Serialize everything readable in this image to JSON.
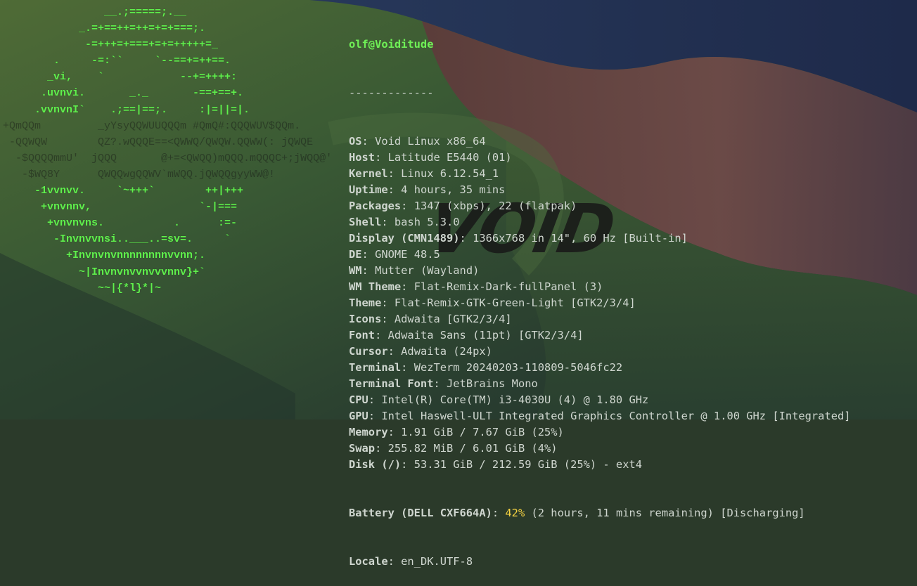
{
  "colors": {
    "logo_green": "#5ff04c",
    "title_green": "#6ff056",
    "text": "#cfd6cf",
    "battery_percent": "#f5d242"
  },
  "wallpaper": {
    "wordmark": "VOID"
  },
  "logo_lines": [
    "                __.;=====;.__",
    "            _.=+==++=++=+=+===;.",
    "             -=+++=+===+=+=+++++=_",
    "        .     -=:``     `--==+=++==.",
    "       _vi,    `            --+=++++:",
    "      .uvnvi.       _._       -==+==+.",
    "     .vvnvnI`    .;==|==;.     :|=||=|.",
    "+QmQQm         _yYsyQQWUUQQQm #QmQ#:QQQWUV$QQm.",
    " -QQWQW        QZ?.wQQQE==<QWWQ/QWQW.QQWW(: jQWQE",
    "  -$QQQQmmU'  jQQQ       @+=<QWQQ)mQQQ.mQQQC+;jWQQ@'",
    "   -$WQ8Y      QWQQwgQQWV`mWQQ.jQWQQgyyWW@!",
    "     -1vvnvv.     `~+++`        ++|+++",
    "      +vnvnnv,                 `-|===",
    "       +vnvnvns.           .      :=-",
    "        -Invnvvnsi..___..=sv=.     `",
    "          +Invnvnvnnnnnnnnvvnn;.",
    "            ~|Invnvnvvnvvvnnv}+`",
    "               ~~|{*l}*|~"
  ],
  "fetch": {
    "user_host": "olf@Voiditude",
    "separator": "-------------",
    "rows": [
      {
        "key": "OS",
        "value": "Void Linux x86_64"
      },
      {
        "key": "Host",
        "value": "Latitude E5440 (01)"
      },
      {
        "key": "Kernel",
        "value": "Linux 6.12.54_1"
      },
      {
        "key": "Uptime",
        "value": "4 hours, 35 mins"
      },
      {
        "key": "Packages",
        "value": "1347 (xbps), 22 (flatpak)"
      },
      {
        "key": "Shell",
        "value": "bash 5.3.0"
      },
      {
        "key": "Display (CMN1489)",
        "value": "1366x768 in 14\", 60 Hz [Built-in]"
      },
      {
        "key": "DE",
        "value": "GNOME 48.5"
      },
      {
        "key": "WM",
        "value": "Mutter (Wayland)"
      },
      {
        "key": "WM Theme",
        "value": "Flat-Remix-Dark-fullPanel (3)"
      },
      {
        "key": "Theme",
        "value": "Flat-Remix-GTK-Green-Light [GTK2/3/4]"
      },
      {
        "key": "Icons",
        "value": "Adwaita [GTK2/3/4]"
      },
      {
        "key": "Font",
        "value": "Adwaita Sans (11pt) [GTK2/3/4]"
      },
      {
        "key": "Cursor",
        "value": "Adwaita (24px)"
      },
      {
        "key": "Terminal",
        "value": "WezTerm 20240203-110809-5046fc22"
      },
      {
        "key": "Terminal Font",
        "value": "JetBrains Mono"
      },
      {
        "key": "CPU",
        "value": "Intel(R) Core(TM) i3-4030U (4) @ 1.80 GHz"
      },
      {
        "key": "GPU",
        "value": "Intel Haswell-ULT Integrated Graphics Controller @ 1.00 GHz [Integrated]"
      },
      {
        "key": "Memory",
        "value": "1.91 GiB / 7.67 GiB (25%)"
      },
      {
        "key": "Swap",
        "value": "255.82 MiB / 6.01 GiB (4%)"
      },
      {
        "key": "Disk (/)",
        "value": "53.31 GiB / 212.59 GiB (25%) - ext4"
      }
    ],
    "battery": {
      "key": "Battery (DELL CXF664A)",
      "percent": "42%",
      "rest": "(2 hours, 11 mins remaining) [Discharging]"
    },
    "locale": {
      "key": "Locale",
      "value": "en_DK.UTF-8"
    }
  }
}
